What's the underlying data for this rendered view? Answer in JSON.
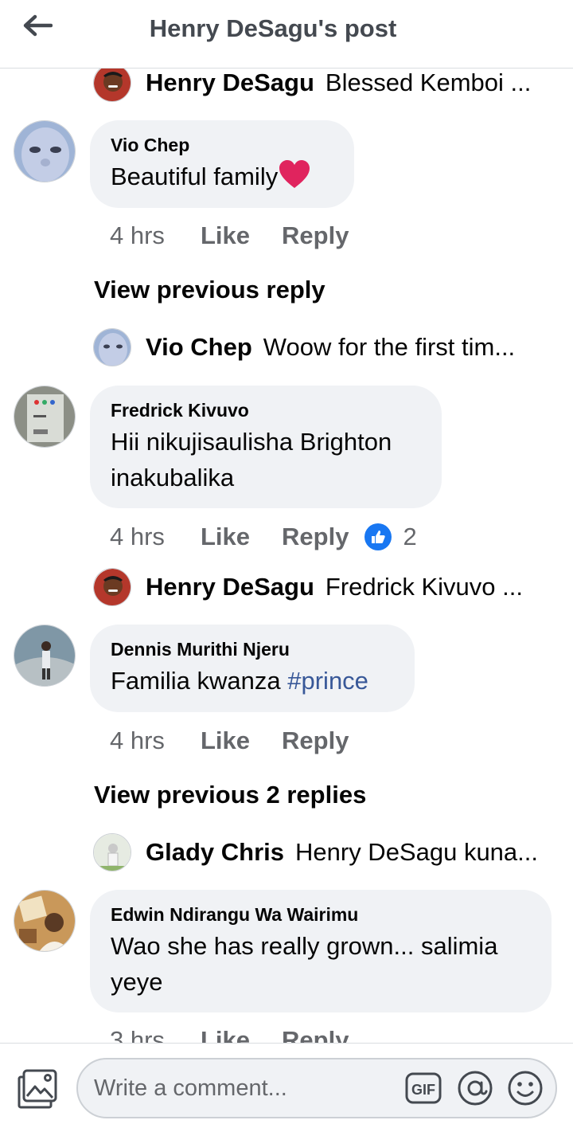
{
  "header": {
    "title": "Henry DeSagu's post"
  },
  "comments": [
    {
      "reply_preview": {
        "name": "Henry DeSagu",
        "text": "Blessed Kemboi ..."
      }
    },
    {
      "author": "Vio Chep",
      "text": "Beautiful family",
      "time": "4 hrs",
      "like_label": "Like",
      "reply_label": "Reply",
      "view_previous": "View previous reply",
      "reply_preview": {
        "name": "Vio Chep",
        "text": "Woow for the first tim..."
      }
    },
    {
      "author": "Fredrick Kivuvo",
      "text": "Hii nikujisaulisha Brighton inakubalika",
      "time": "4 hrs",
      "like_label": "Like",
      "reply_label": "Reply",
      "reactions": "2",
      "reply_preview": {
        "name": "Henry DeSagu",
        "text": "Fredrick Kivuvo ..."
      }
    },
    {
      "author": "Dennis Murithi Njeru",
      "text": "Familia kwanza ",
      "hashtag": "#prince",
      "time": "4 hrs",
      "like_label": "Like",
      "reply_label": "Reply",
      "view_previous": "View previous 2 replies",
      "reply_preview": {
        "name": "Glady Chris",
        "text": "Henry DeSagu kuna..."
      }
    },
    {
      "author": "Edwin Ndirangu Wa Wairimu",
      "text": "Wao she has really grown... salimia yeye",
      "time": "3 hrs",
      "like_label": "Like",
      "reply_label": "Reply"
    }
  ],
  "composer": {
    "placeholder": "Write a comment...",
    "gif_label": "GIF"
  },
  "colors": {
    "hashtag": "#385898",
    "reaction_blue": "#1877f2",
    "heart_red": "#e0245e",
    "bubble_bg": "#f0f2f5"
  },
  "icons": [
    "back-arrow-icon",
    "heart-icon",
    "like-reaction-icon",
    "photo-icon",
    "gif-icon",
    "mention-icon",
    "emoji-icon"
  ]
}
